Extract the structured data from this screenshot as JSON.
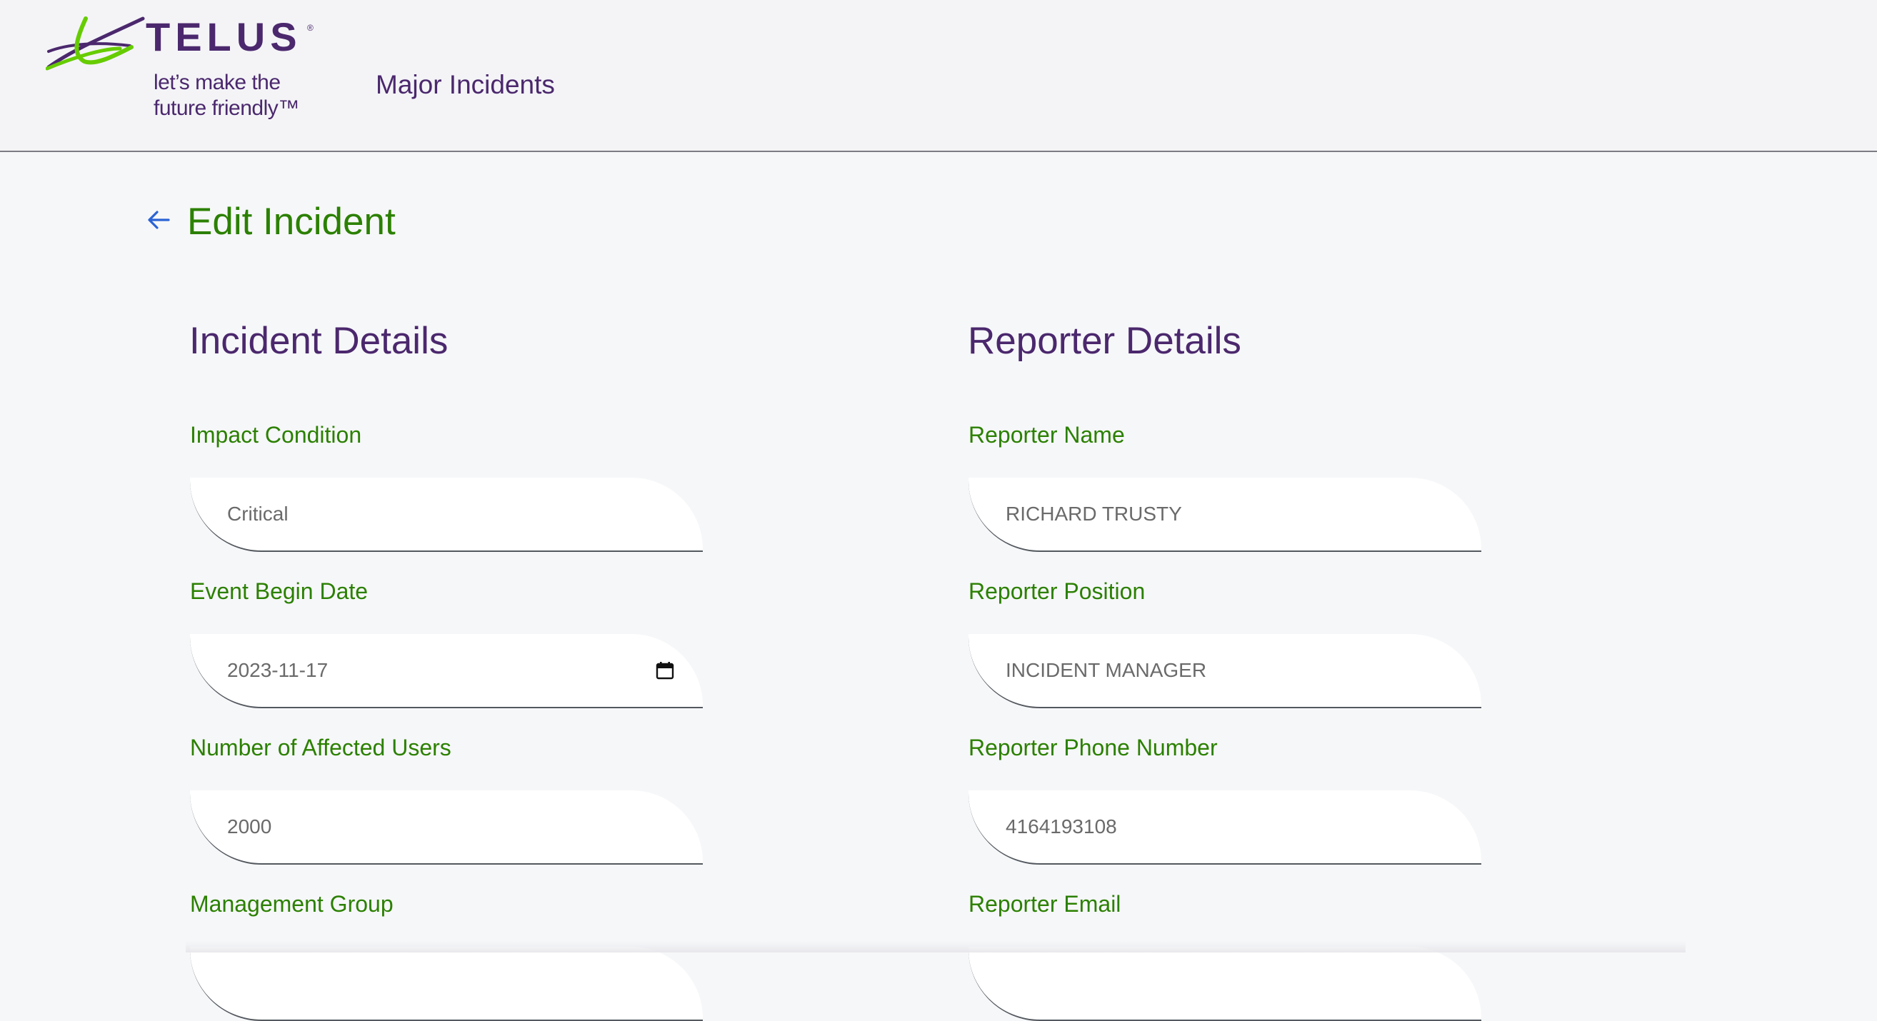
{
  "header": {
    "logo": {
      "brand": "TELUS",
      "registered_mark": "®",
      "tagline_line1": "let’s make the",
      "tagline_line2": "future friendly™"
    },
    "app_title": "Major Incidents"
  },
  "page": {
    "title": "Edit Incident",
    "back_icon": "arrow-left-icon"
  },
  "incident_details": {
    "title": "Incident Details",
    "fields": [
      {
        "label": "Impact Condition",
        "value": "Critical"
      },
      {
        "label": "Event Begin Date",
        "value": "2023-11-17",
        "icon": "calendar-icon"
      },
      {
        "label": "Number of Affected Users",
        "value": "2000"
      },
      {
        "label": "Management Group",
        "value": ""
      }
    ]
  },
  "reporter_details": {
    "title": "Reporter Details",
    "fields": [
      {
        "label": "Reporter Name",
        "value": "RICHARD TRUSTY"
      },
      {
        "label": "Reporter Position",
        "value": "INCIDENT MANAGER"
      },
      {
        "label": "Reporter Phone Number",
        "value": "4164193108"
      },
      {
        "label": "Reporter Email",
        "value": ""
      }
    ]
  },
  "colors": {
    "brand_purple": "#4b286d",
    "brand_green": "#2b8000",
    "logo_green": "#66cc00",
    "back_arrow_blue": "#2a63d4"
  }
}
